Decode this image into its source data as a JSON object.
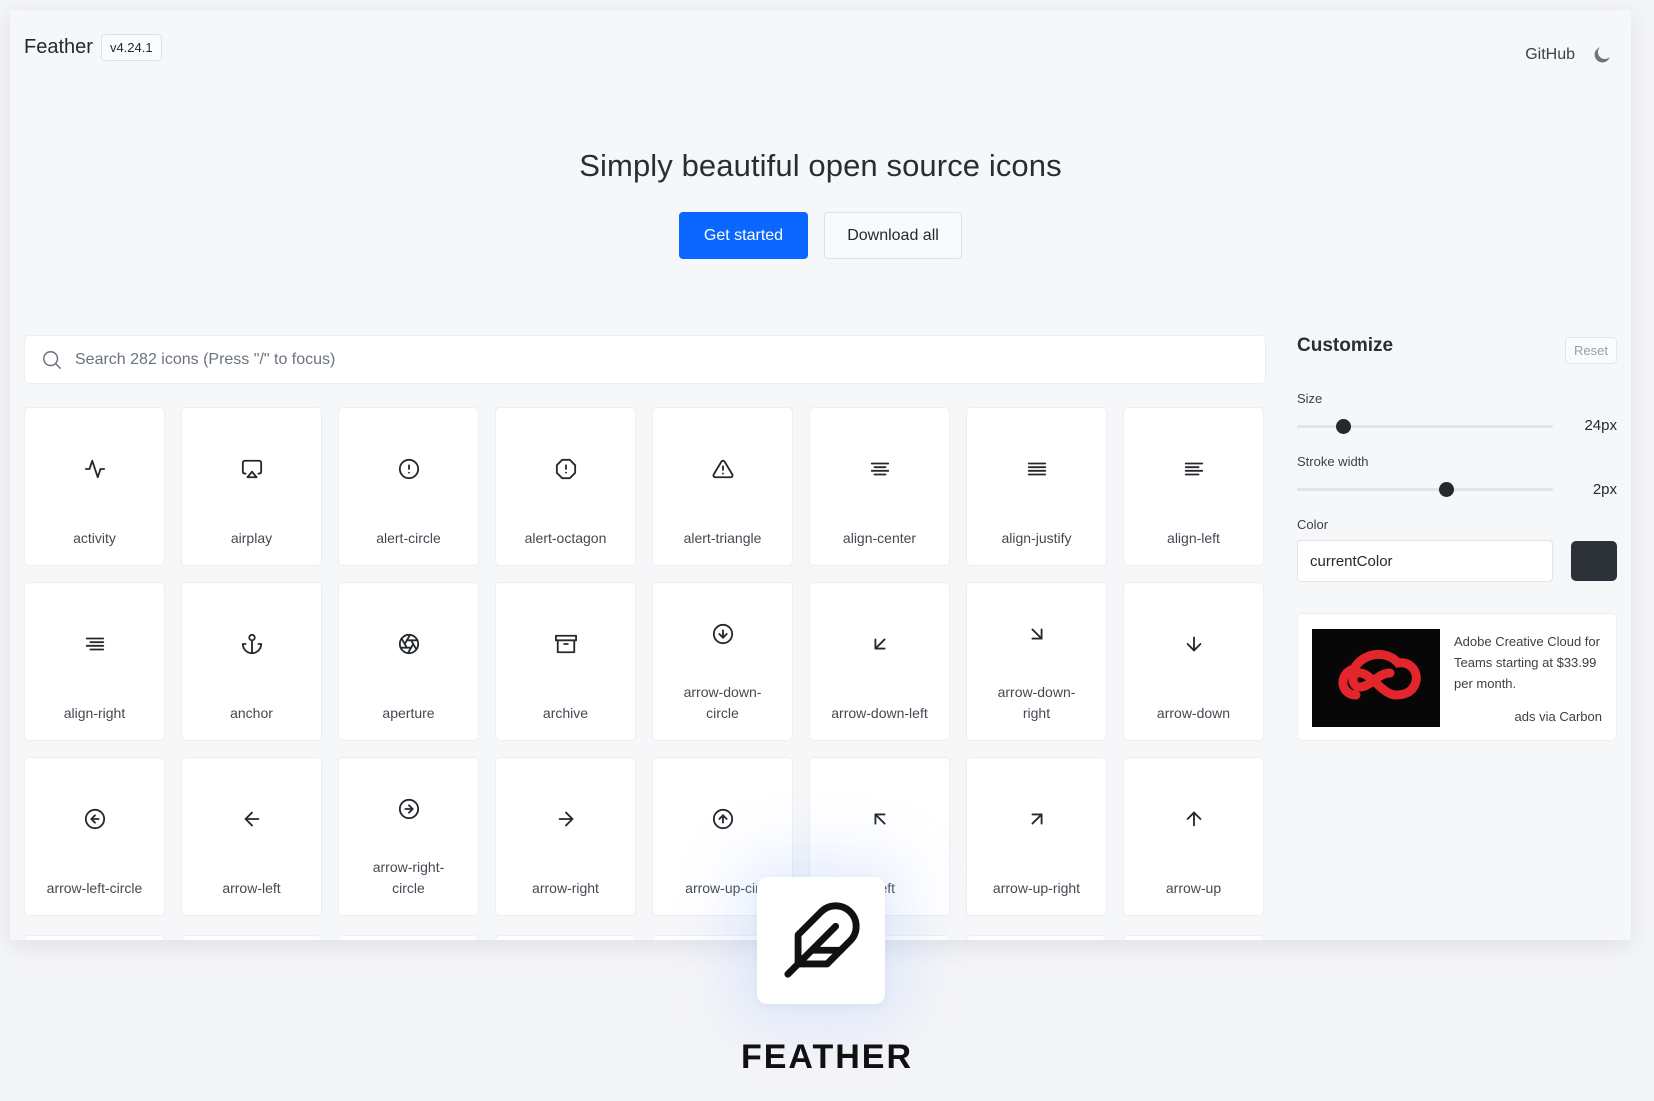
{
  "header": {
    "brand": "Feather",
    "version": "v4.24.1",
    "github_label": "GitHub",
    "theme_toggle_icon": "moon-icon"
  },
  "hero": {
    "title": "Simply beautiful open source icons",
    "primary_button": "Get started",
    "secondary_button": "Download all"
  },
  "search": {
    "placeholder": "Search 282 icons (Press \"/\" to focus)",
    "value": ""
  },
  "icons": [
    {
      "label": "activity",
      "icon": "activity-icon"
    },
    {
      "label": "airplay",
      "icon": "airplay-icon"
    },
    {
      "label": "alert-circle",
      "icon": "alert-circle-icon"
    },
    {
      "label": "alert-octagon",
      "icon": "alert-octagon-icon"
    },
    {
      "label": "alert-triangle",
      "icon": "alert-triangle-icon"
    },
    {
      "label": "align-center",
      "icon": "align-center-icon"
    },
    {
      "label": "align-justify",
      "icon": "align-justify-icon"
    },
    {
      "label": "align-left",
      "icon": "align-left-icon"
    },
    {
      "label": "align-right",
      "icon": "align-right-icon"
    },
    {
      "label": "anchor",
      "icon": "anchor-icon"
    },
    {
      "label": "aperture",
      "icon": "aperture-icon"
    },
    {
      "label": "archive",
      "icon": "archive-icon"
    },
    {
      "label": "arrow-down-\ncircle",
      "icon": "arrow-down-circle-icon"
    },
    {
      "label": "arrow-down-left",
      "icon": "arrow-down-left-icon"
    },
    {
      "label": "arrow-down-\nright",
      "icon": "arrow-down-right-icon"
    },
    {
      "label": "arrow-down",
      "icon": "arrow-down-icon"
    },
    {
      "label": "arrow-left-circle",
      "icon": "arrow-left-circle-icon"
    },
    {
      "label": "arrow-left",
      "icon": "arrow-left-icon"
    },
    {
      "label": "arrow-right-\ncircle",
      "icon": "arrow-right-circle-icon"
    },
    {
      "label": "arrow-right",
      "icon": "arrow-right-icon"
    },
    {
      "label": "arrow-up-cir",
      "icon": "arrow-up-circle-icon"
    },
    {
      "label": "p-left",
      "icon": "arrow-up-left-icon"
    },
    {
      "label": "arrow-up-right",
      "icon": "arrow-up-right-icon"
    },
    {
      "label": "arrow-up",
      "icon": "arrow-up-icon"
    }
  ],
  "customize": {
    "title": "Customize",
    "reset_label": "Reset",
    "size_label": "Size",
    "size_value": "24px",
    "size_fraction": 0.16,
    "stroke_label": "Stroke width",
    "stroke_value": "2px",
    "stroke_fraction": 0.59,
    "color_label": "Color",
    "color_value": "currentColor",
    "swatch_color": "#2d3239"
  },
  "ad": {
    "text": "Adobe Creative Cloud for Teams starting at $33.99 per month.",
    "via": "ads via Carbon",
    "logo_icon": "adobe-creative-cloud-logo"
  },
  "logo": {
    "icon": "feather-icon",
    "wordmark": "FEATHER"
  },
  "colors": {
    "accent": "#0b67ff",
    "background": "#f6f7f9",
    "ad_logo_red": "#e3262b"
  }
}
